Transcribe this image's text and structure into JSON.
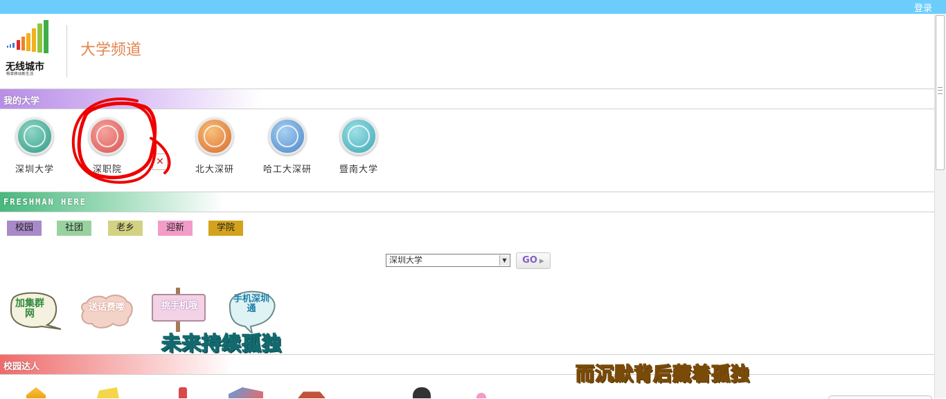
{
  "topbar": {
    "login_label": "登录"
  },
  "header": {
    "logo_text": "无线城市",
    "logo_subtext": "畅享移动新生活",
    "channel_title": "大学频道"
  },
  "sections": {
    "my_university": "我的大学",
    "freshman": "FRESHMAN HERE",
    "campus_stars": "校园达人"
  },
  "universities": [
    {
      "name": "深圳大学",
      "badge_color": "#3aa793"
    },
    {
      "name": "深职院",
      "badge_color": "#d9534f"
    },
    {
      "name": "北大深研",
      "badge_color": "#d9682a"
    },
    {
      "name": "哈工大深研",
      "badge_color": "#4a86c8"
    },
    {
      "name": "暨南大学",
      "badge_color": "#3aa7b5"
    }
  ],
  "remove_icon": "close-icon",
  "tags": [
    {
      "label": "校园",
      "color": "#a98ac9"
    },
    {
      "label": "社团",
      "color": "#9ad29f"
    },
    {
      "label": "老乡",
      "color": "#d2d282"
    },
    {
      "label": "迎新",
      "color": "#f29cc8"
    },
    {
      "label": "学院",
      "color": "#d4a31b"
    }
  ],
  "select": {
    "selected": "深圳大学"
  },
  "go_button": {
    "label": "GO"
  },
  "stickers": [
    {
      "text": "加集群网"
    },
    {
      "text": "送话费喽"
    },
    {
      "text": "挑手机哦"
    },
    {
      "text": "手机深圳通"
    }
  ],
  "overlays": {
    "line1": "未来持续孤独",
    "line2": "而沉默背后藏着孤独"
  },
  "colors": {
    "topbar": "#6ccdfc",
    "accent_title": "#e0854f",
    "annotation_circle": "#ee0000"
  }
}
